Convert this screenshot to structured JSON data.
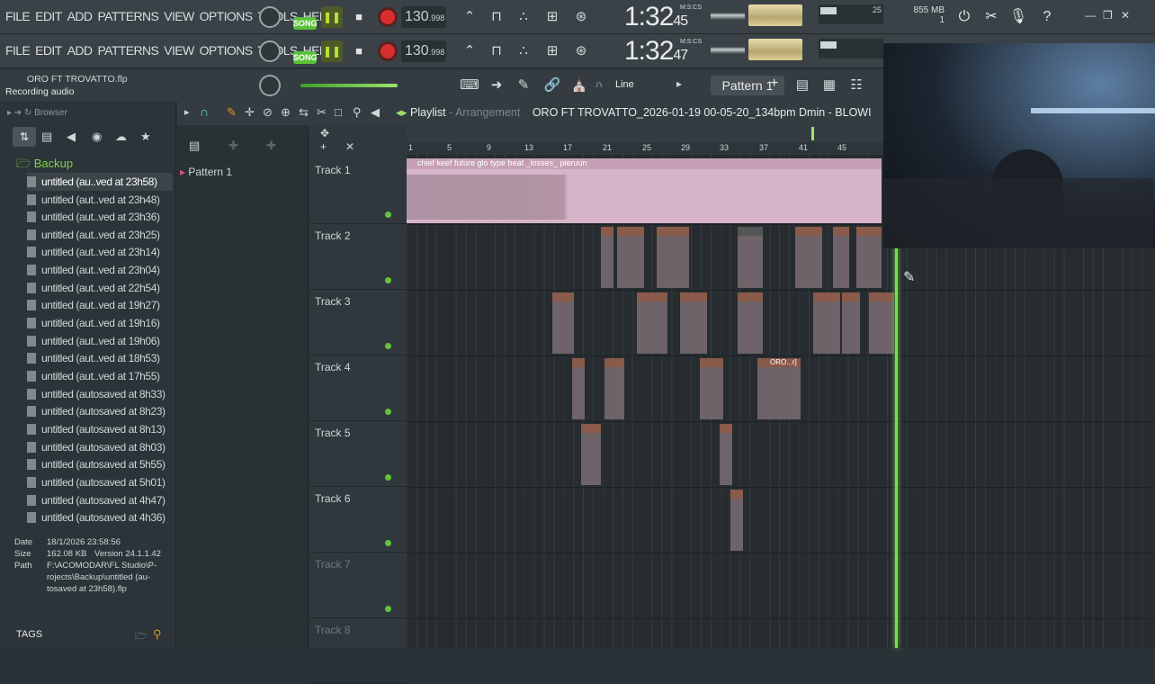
{
  "menu": [
    "FILE",
    "EDIT",
    "ADD",
    "PATTERNS",
    "VIEW",
    "OPTIONS",
    "TOOLS",
    "HELP"
  ],
  "transport": {
    "song_label": "SONG",
    "tempo": "130",
    "tempo_frac": ".998",
    "time1": "1:32",
    "time1_s": "45",
    "time2": "1:32",
    "time2_s": "47",
    "time_label": "M:S:CS"
  },
  "memory": {
    "mem": "855 MB",
    "cpu": "1",
    "poly": "25"
  },
  "project": {
    "file": "ORO FT TROVATTO.flp",
    "status": "Recording audio"
  },
  "toolbar3": {
    "snap": "Line",
    "pattern": "Pattern 1"
  },
  "browser": {
    "title": "Browser",
    "folder": "Backup",
    "items": [
      "untitled (au..ved at 23h58)",
      "untitled (aut..ved at 23h48)",
      "untitled (aut..ved at 23h36)",
      "untitled (aut..ved at 23h25)",
      "untitled (aut..ved at 23h14)",
      "untitled (aut..ved at 23h04)",
      "untitled (aut..ved at 22h54)",
      "untitled (aut..ved at 19h27)",
      "untitled (aut..ved at 19h16)",
      "untitled (aut..ved at 19h06)",
      "untitled (aut..ved at 18h53)",
      "untitled (aut..ved at 17h55)",
      "untitled (autosaved at 8h33)",
      "untitled (autosaved at 8h23)",
      "untitled (autosaved at 8h13)",
      "untitled (autosaved at 8h03)",
      "untitled (autosaved at 5h55)",
      "untitled (autosaved at 5h01)",
      "untitled (autosaved at 4h47)",
      "untitled (autosaved at 4h36)"
    ],
    "info": {
      "date_label": "Date",
      "date": "18/1/2026 23:58:56",
      "size_label": "Size",
      "size": "162.08 KB",
      "version": "Version 24.1.1.42",
      "path_label": "Path",
      "path1": "F:\\ACOMODAR\\FL Studio\\P-",
      "path2": "rojects\\Backup\\untitled (au-",
      "path3": "tosaved at 23h58).flp"
    },
    "tags": "TAGS"
  },
  "patterns": {
    "item": "Pattern 1"
  },
  "playlist": {
    "title": "Playlist",
    "sep": " - ",
    "mode": "Arrangement",
    "project": "ORO FT TROVATTO_2026-01-19 00-05-20_134bpm Dmin - BLOWI"
  },
  "ruler": [
    "1",
    "5",
    "9",
    "13",
    "17",
    "21",
    "25",
    "29",
    "33",
    "37",
    "41",
    "45"
  ],
  "tracks": [
    "Track 1",
    "Track 2",
    "Track 3",
    "Track 4",
    "Track 5",
    "Track 6",
    "Track 7",
    "Track 8"
  ],
  "clips": {
    "track1": "chief keef future glo type beat _losses_ pieruun",
    "track4_label": "ORO...r]"
  }
}
